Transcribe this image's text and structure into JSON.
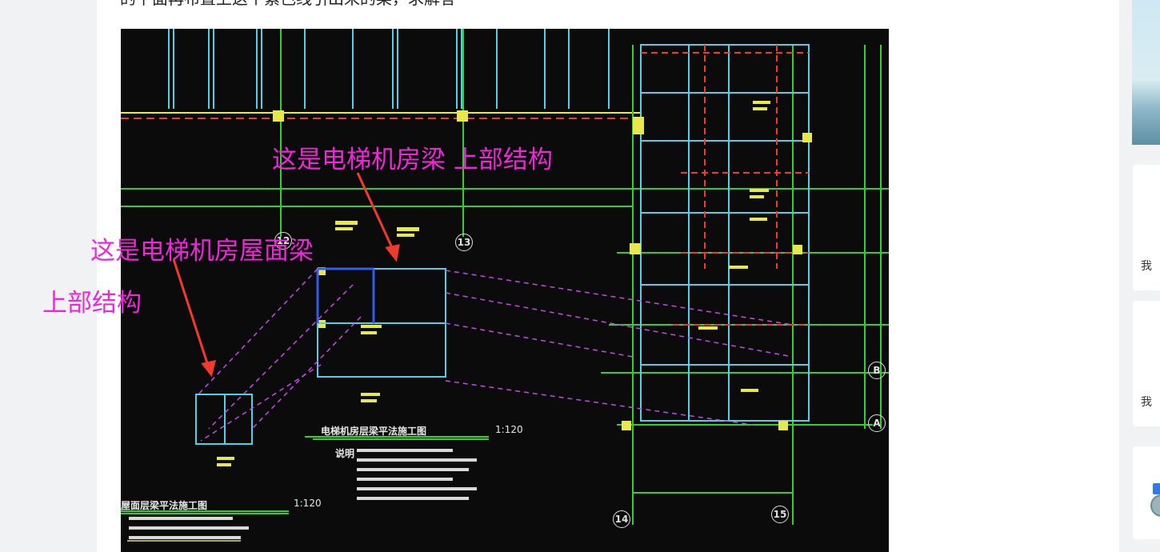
{
  "question": {
    "text": "的下面再布置上这个紫色线引出来的梁，求解答"
  },
  "annotations": {
    "upper_beam_label": "这是电梯机房梁 上部结构",
    "roof_beam_label_line1": "这是电梯机房屋面梁",
    "roof_beam_label_line2": "上部结构"
  },
  "cad": {
    "caption_main": "电梯机房层梁平法施工图",
    "caption_main_scale": "1:120",
    "caption_left": "屋面层梁平法施工图",
    "caption_left_scale": "1:120",
    "notes_title": "说明",
    "axis_12": "12",
    "axis_13": "13",
    "axis_14": "14",
    "axis_15": "15",
    "axis_B": "B",
    "axis_A": "A"
  },
  "sidebar": {
    "card_label_1": "我",
    "card_label_2": "我"
  },
  "colors": {
    "annotation": "#ee27d8",
    "arrow": "#f23a2a",
    "cad_background": "#0b0b0c",
    "grid_green": "#2fd12f",
    "beam_yellow": "#e8e84a",
    "beam_cyan": "#4fd2e8"
  }
}
